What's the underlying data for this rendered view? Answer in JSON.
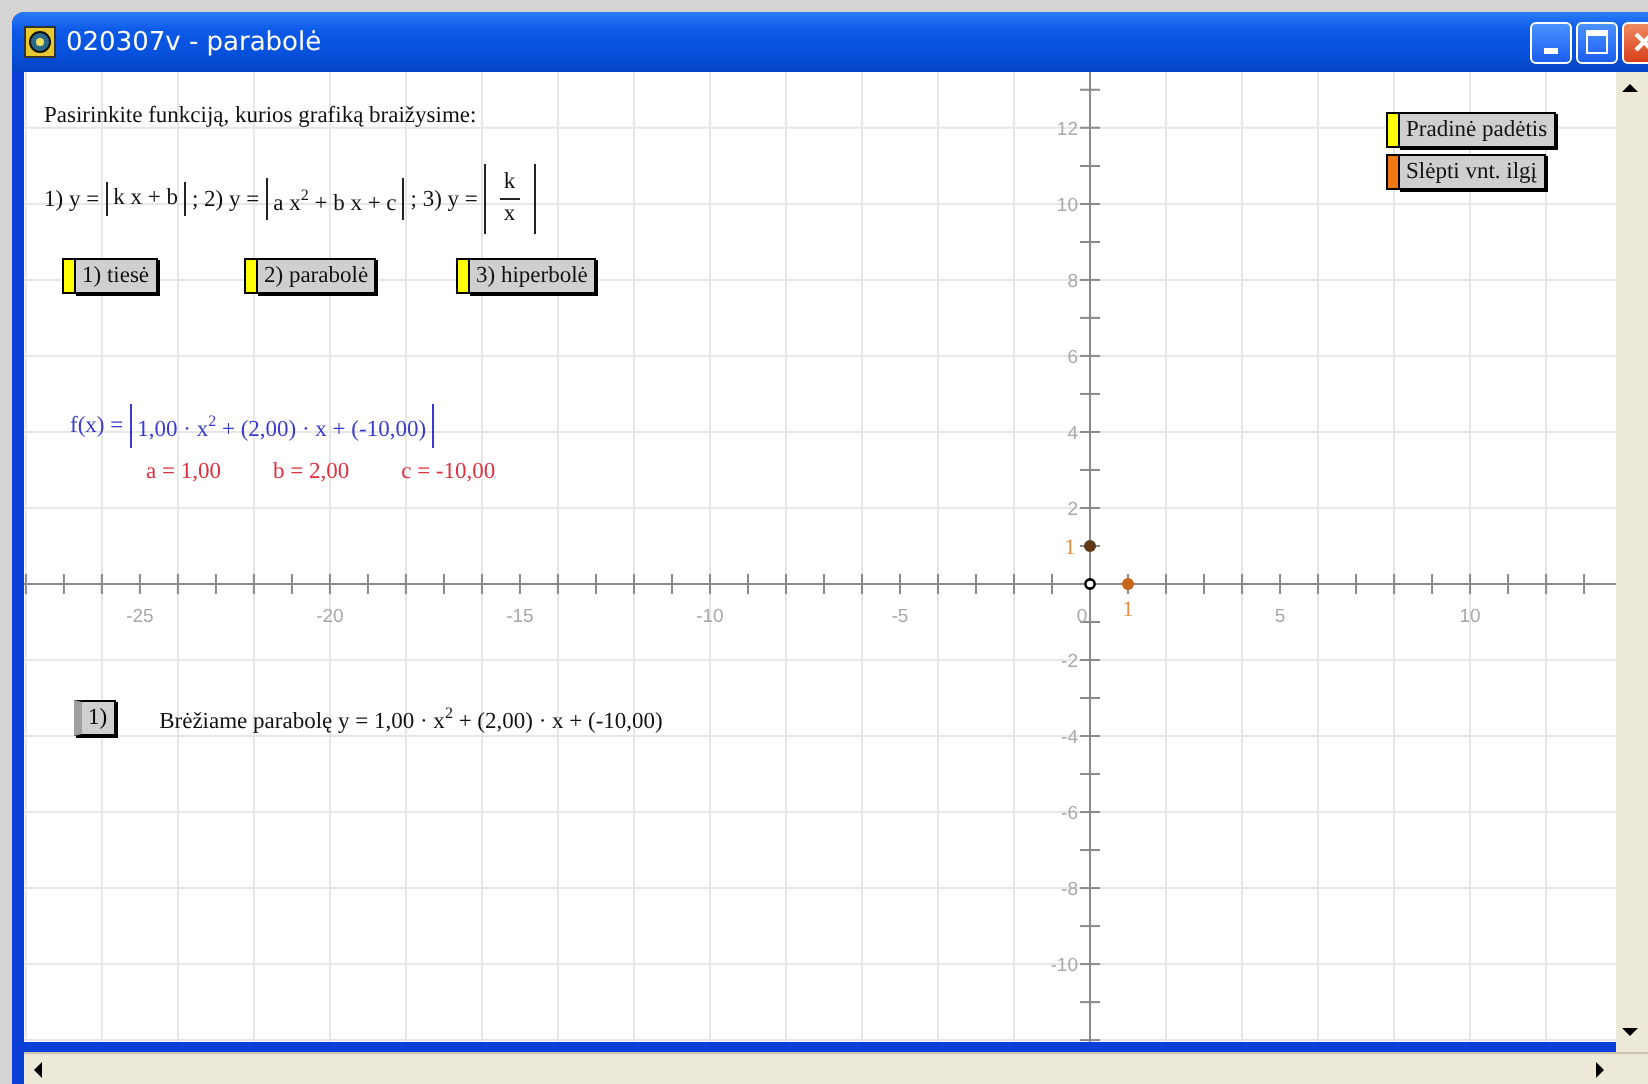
{
  "window": {
    "title": "020307v - parabolė"
  },
  "instruction": "Pasirinkite funkciją, kurios grafiką braižysime:",
  "formula_line": [
    {
      "kind": "text",
      "text": "1) y ="
    },
    {
      "kind": "abs",
      "text": "k x + b"
    },
    {
      "kind": "text",
      "text": ";  2) y ="
    },
    {
      "kind": "abs",
      "text": "a x$^{2}$ + b x + c"
    },
    {
      "kind": "text",
      "text": "; 3) y ="
    },
    {
      "kind": "abs_fraction",
      "numerator": "k",
      "denominator": "x"
    }
  ],
  "function_buttons": [
    {
      "label": "1) tiesė",
      "color": "#ffff00"
    },
    {
      "label": "2) parabolė",
      "color": "#ffff00"
    },
    {
      "label": "3) hiperbolė",
      "color": "#ffff00"
    }
  ],
  "side_buttons": [
    {
      "label": "Pradinė padėtis",
      "color": "#ffff00"
    },
    {
      "label": "Slėpti vnt. ilgį",
      "color": "#f07810"
    }
  ],
  "function_display": {
    "label": "f(x) =",
    "expr": "1,00 · x$^{2}$ + (2,00) · x + (-10,00)"
  },
  "parameters": [
    "a = 1,00",
    "b = 2,00",
    "c = -10,00"
  ],
  "step": {
    "button": "1)",
    "text": "Brėžiame parabolę y = 1,00 · x$^{2}$ + (2,00) · x + (-10,00)"
  },
  "plane": {
    "chart_data": {
      "type": "scatter",
      "xlim": [
        -28.05,
        13.84
      ],
      "ylim": [
        -12.05,
        13.47
      ],
      "grid": true,
      "xticks": [
        -25,
        -20,
        -15,
        -10,
        -5,
        0,
        5,
        10
      ],
      "yticks": [
        -10,
        -8,
        -6,
        -4,
        -2,
        2,
        4,
        6,
        8,
        10,
        12
      ],
      "x": [
        0,
        1
      ],
      "series": [
        {
          "color": "#603818",
          "values": [
            1,
            null
          ]
        },
        {
          "color": "#c86418",
          "values": [
            null,
            0
          ]
        },
        {
          "color": "#000000",
          "values": [
            0,
            null
          ]
        }
      ],
      "annotations": [
        {
          "x": 1,
          "y": 0,
          "text": "1"
        },
        {
          "x": 0,
          "y": 1,
          "text": "1"
        }
      ]
    }
  }
}
